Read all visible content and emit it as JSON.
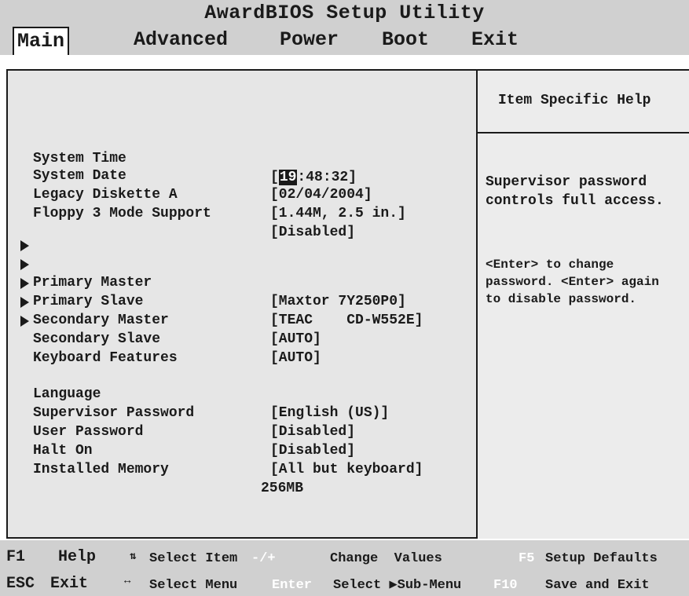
{
  "title": "AwardBIOS Setup Utility",
  "menu": {
    "items": [
      {
        "label": "Main",
        "active": true
      },
      {
        "label": "Advanced"
      },
      {
        "label": "Power"
      },
      {
        "label": "Boot"
      },
      {
        "label": "Exit"
      }
    ]
  },
  "settings": {
    "system_time": {
      "label": "System Time",
      "value_open": "[",
      "value_hour": "19",
      "value_rest": ":48:32]"
    },
    "system_date": {
      "label": "System Date",
      "value": "[02/04/2004]"
    },
    "legacy_diskette": {
      "label": "Legacy Diskette A",
      "value": "[1.44M, 2.5 in.]"
    },
    "floppy_mode": {
      "label": "Floppy 3 Mode Support",
      "value": "[Disabled]"
    },
    "primary_master": {
      "label": "Primary Master",
      "value": "[Maxtor 7Y250P0]"
    },
    "primary_slave": {
      "label": "Primary Slave",
      "value": "[TEAC    CD-W552E]"
    },
    "secondary_master": {
      "label": "Secondary Master",
      "value": "[AUTO]"
    },
    "secondary_slave": {
      "label": "Secondary Slave",
      "value": "[AUTO]"
    },
    "keyboard_features": {
      "label": "Keyboard Features"
    },
    "language": {
      "label": "Language",
      "value": "[English (US)]"
    },
    "supervisor_password": {
      "label": "Supervisor Password",
      "value": "[Disabled]"
    },
    "user_password": {
      "label": "User Password",
      "value": "[Disabled]"
    },
    "halt_on": {
      "label": "Halt On",
      "value": "[All but keyboard]"
    },
    "installed_memory": {
      "label": "Installed Memory",
      "value": "256MB"
    }
  },
  "help": {
    "title": "Item Specific Help",
    "description": "Supervisor password\ncontrols full access.",
    "note": "<Enter> to change\npassword. <Enter> again\nto disable password."
  },
  "footer": {
    "f1": "F1",
    "help": "Help",
    "select_item": "Select Item",
    "minus_plus": "-/+",
    "change_values": "Change  Values",
    "f5": "F5",
    "setup_defaults": "Setup Defaults",
    "esc": "ESC",
    "exit": "Exit",
    "select_menu": "Select Menu",
    "enter": "Enter",
    "select_submenu": "Select ▶Sub-Menu",
    "f10": "F10",
    "save_exit": "Save and Exit"
  },
  "colors": {
    "bar": "#d0d0d0",
    "panel": "#e6e6e6",
    "text": "#1a1a1a",
    "key_highlight": "#ffffff"
  },
  "icons": [
    "updown-arrows-icon",
    "leftright-arrows-icon",
    "submenu-arrow-icon"
  ]
}
